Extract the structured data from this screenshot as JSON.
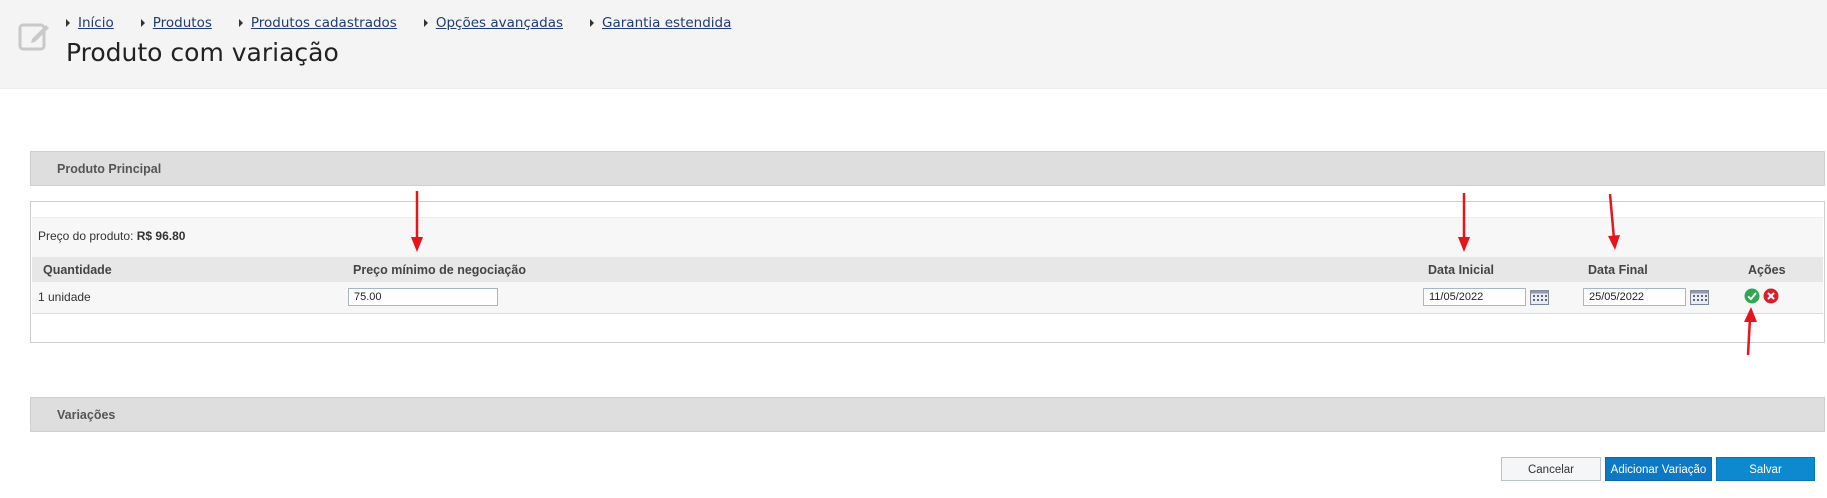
{
  "breadcrumb": {
    "items": [
      {
        "label": "Início"
      },
      {
        "label": "Produtos"
      },
      {
        "label": "Produtos cadastrados"
      },
      {
        "label": "Opções avançadas"
      },
      {
        "label": "Garantia estendida"
      }
    ]
  },
  "page": {
    "title": "Produto com variação"
  },
  "main_product": {
    "section_title": "Produto Principal",
    "price_label": "Preço do produto:",
    "price_value": "R$ 96.80",
    "columns": {
      "quantity": "Quantidade",
      "min_price": "Preço mínimo de negociação",
      "start_date": "Data Inicial",
      "end_date": "Data Final",
      "actions": "Ações"
    },
    "row": {
      "quantity": "1 unidade",
      "min_price": "75.00",
      "start_date": "11/05/2022",
      "end_date": "25/05/2022"
    }
  },
  "variations": {
    "section_title": "Variações"
  },
  "buttons": {
    "cancel": "Cancelar",
    "add_variation": "Adicionar Variação",
    "save": "Salvar"
  },
  "colors": {
    "accent": "#0d89d0",
    "link": "#1f3c73",
    "arrow": "#e8141c",
    "ok": "#2fa84f",
    "cancel_icon": "#d6202a"
  },
  "icons": {
    "page": "edit-icon",
    "calendar": "calendar-icon",
    "confirm": "check-circle-icon",
    "remove": "x-circle-icon"
  }
}
